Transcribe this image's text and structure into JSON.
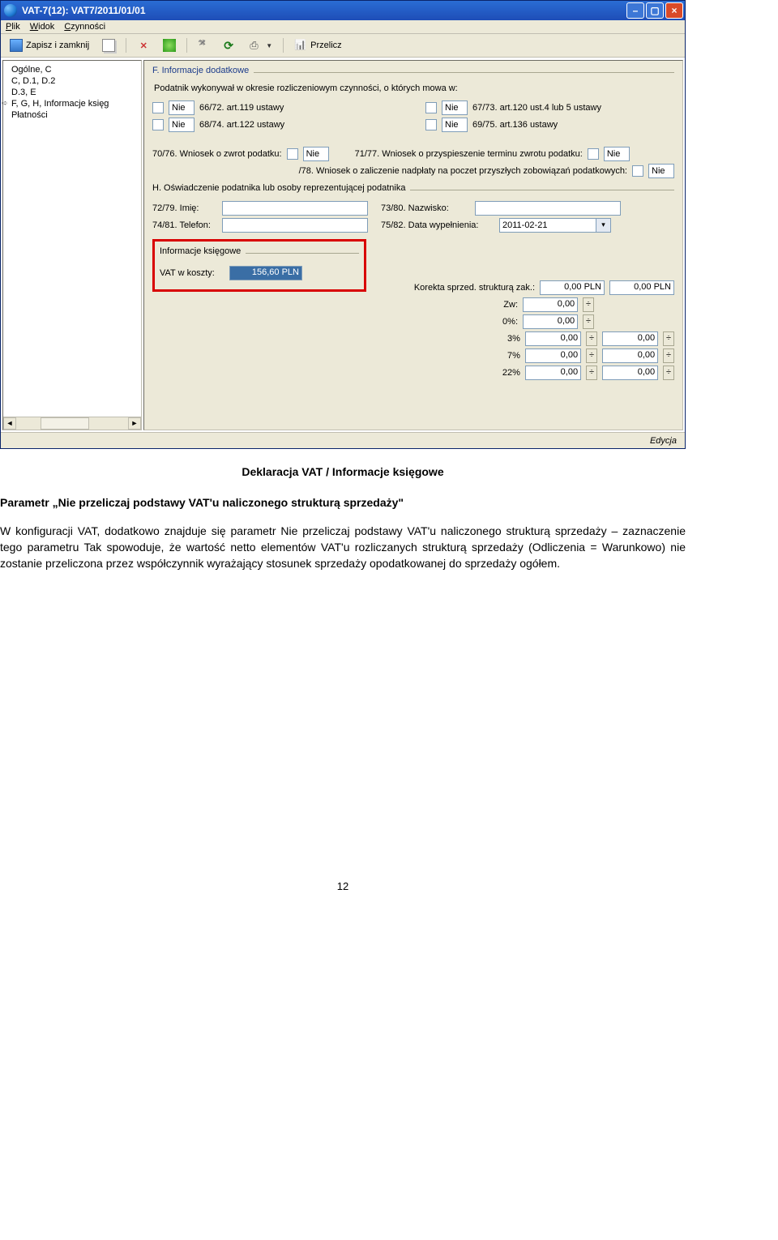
{
  "titlebar": {
    "title": "VAT-7(12): VAT7/2011/01/01"
  },
  "menubar": {
    "plik_html": "<u>P</u>lik",
    "widok_html": "<u>W</u>idok",
    "czynnosci_html": "<u>C</u>zynności"
  },
  "toolbar": {
    "save_close": "Zapisz i zamknij",
    "przelicz": "Przelicz"
  },
  "sidebar": {
    "items": [
      "Ogólne, C",
      "C, D.1, D.2",
      "D.3, E",
      "F, G, H, Informacje księg",
      "Płatności"
    ],
    "selected_index": 3
  },
  "sectionF": {
    "title": "F. Informacje dodatkowe",
    "subtitle": "Podatnik wykonywał w okresie rozliczeniowym czynności, o których mowa w:",
    "rows": {
      "r1l_val": "Nie",
      "r1l_lbl": "66/72. art.119 ustawy",
      "r1r_val": "Nie",
      "r1r_lbl": "67/73. art.120 ust.4 lub 5 ustawy",
      "r2l_val": "Nie",
      "r2l_lbl": "68/74. art.122 ustawy",
      "r2r_val": "Nie",
      "r2r_lbl": "69/75. art.136 ustawy"
    },
    "wniosek_zwrot_lbl": "70/76. Wniosek o zwrot podatku:",
    "wniosek_zwrot_val": "Nie",
    "wniosek_przysp_lbl": "71/77. Wniosek o przyspieszenie terminu zwrotu podatku:",
    "wniosek_przysp_val": "Nie",
    "wniosek_zalicz_lbl": "/78. Wniosek o zaliczenie nadpłaty na poczet przyszłych zobowiązań podatkowych:",
    "wniosek_zalicz_val": "Nie"
  },
  "sectionH": {
    "title": "H. Oświadczenie podatnika lub osoby reprezentującej podatnika",
    "imie_lbl": "72/79. Imię:",
    "nazwisko_lbl": "73/80. Nazwisko:",
    "telefon_lbl": "74/81. Telefon:",
    "data_lbl": "75/82. Data wypełnienia:",
    "data_val": "2011-02-21"
  },
  "sectionKsieg": {
    "title": "Informacje księgowe",
    "vat_koszty_lbl": "VAT w koszty:",
    "vat_koszty_val": "156,60 PLN",
    "korekta_lbl": "Korekta sprzed. strukturą zak.:",
    "korekta_v1": "0,00 PLN",
    "korekta_v2": "0,00 PLN",
    "rows": [
      {
        "lbl": "Zw:",
        "v1": "0,00"
      },
      {
        "lbl": "0%:",
        "v1": "0,00"
      },
      {
        "lbl": "3%",
        "v1": "0,00",
        "v2": "0,00"
      },
      {
        "lbl": "7%",
        "v1": "0,00",
        "v2": "0,00"
      },
      {
        "lbl": "22%",
        "v1": "0,00",
        "v2": "0,00"
      }
    ]
  },
  "statusbar": {
    "text": "Edycja"
  },
  "document": {
    "caption": "Deklaracja VAT / Informacje księgowe",
    "heading": "Parametr „Nie przeliczaj podstawy VAT'u naliczonego strukturą sprzedaży\"",
    "body": "W konfiguracji VAT, dodatkowo znajduje się parametr Nie przeliczaj podstawy VAT'u naliczonego strukturą sprzedaży – zaznaczenie tego parametru Tak spowoduje, że wartość netto elementów VAT'u rozliczanych strukturą sprzedaży (Odliczenia = Warunkowo) nie zostanie przeliczona przez współczynnik wyrażający stosunek sprzedaży opodatkowanej do sprzedaży ogółem.",
    "pagenum": "12"
  }
}
